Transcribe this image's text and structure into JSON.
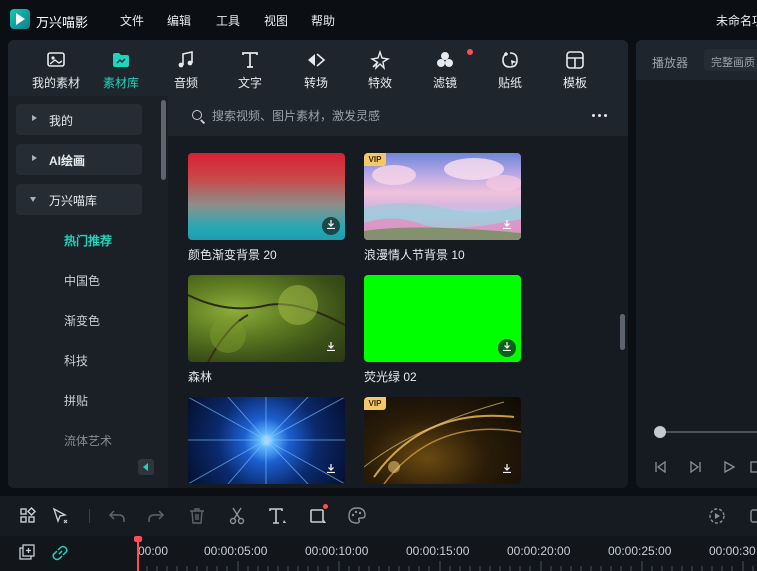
{
  "app": {
    "title": "万兴喵影",
    "document_title": "未命名项"
  },
  "menu": [
    "文件",
    "编辑",
    "工具",
    "视图",
    "帮助"
  ],
  "tabs": [
    {
      "label": "我的素材",
      "icon": "my-media-icon",
      "active": false
    },
    {
      "label": "素材库",
      "icon": "stock-library-icon",
      "active": true
    },
    {
      "label": "音频",
      "icon": "audio-icon",
      "active": false
    },
    {
      "label": "文字",
      "icon": "text-icon",
      "active": false
    },
    {
      "label": "转场",
      "icon": "transition-icon",
      "active": false
    },
    {
      "label": "特效",
      "icon": "effects-icon",
      "active": false
    },
    {
      "label": "滤镜",
      "icon": "filter-icon",
      "active": false,
      "notification": true
    },
    {
      "label": "贴纸",
      "icon": "sticker-icon",
      "active": false
    },
    {
      "label": "模板",
      "icon": "template-icon",
      "active": false
    }
  ],
  "sidebar": {
    "groups": [
      {
        "label": "我的",
        "expanded": false
      },
      {
        "label": "AI绘画",
        "expanded": false
      },
      {
        "label": "万兴喵库",
        "expanded": true
      }
    ],
    "items": [
      "热门推荐",
      "中国色",
      "渐变色",
      "科技",
      "拼贴",
      "流体艺术"
    ],
    "active_item": "热门推荐"
  },
  "search": {
    "placeholder": "搜索视频、图片素材，激发灵感"
  },
  "media": [
    {
      "label": "颜色渐变背景 20",
      "vip": false
    },
    {
      "label": "浪漫情人节背景 10",
      "vip": true,
      "badge": "VIP"
    },
    {
      "label": "森林",
      "vip": false
    },
    {
      "label": "荧光绿 02",
      "vip": false
    },
    {
      "label": "",
      "vip": false
    },
    {
      "label": "",
      "vip": true,
      "badge": "VIP"
    }
  ],
  "preview": {
    "tab_player": "播放器",
    "tab_quality": "完整画质"
  },
  "timeline": {
    "ruler": [
      "00:00",
      "00:00:05:00",
      "00:00:10:00",
      "00:00:15:00",
      "00:00:20:00",
      "00:00:25:00",
      "00:00:30"
    ]
  },
  "colors": {
    "accent": "#20d3bc",
    "notification": "#ff4d55",
    "vip": "#f4c767"
  }
}
